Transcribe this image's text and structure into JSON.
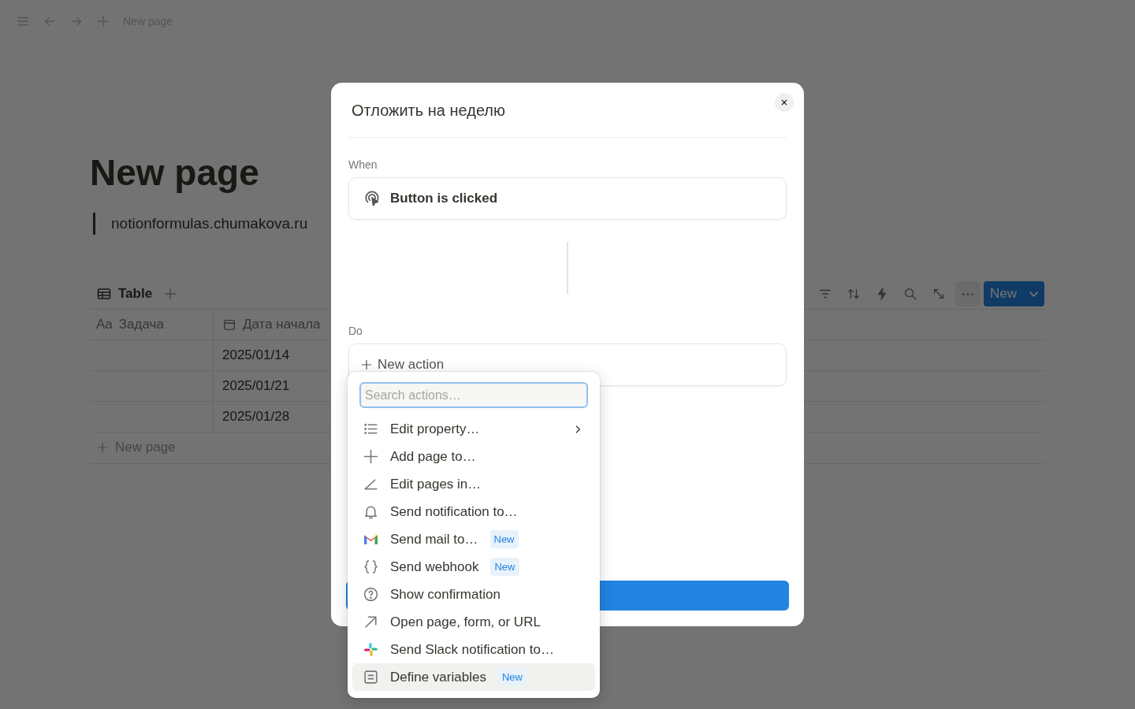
{
  "topbar": {
    "title": "New page"
  },
  "page": {
    "title": "New page",
    "quote": "notionformulas.chumakova.ru"
  },
  "database": {
    "view_tab": "Table",
    "new_button": "New",
    "columns": [
      {
        "label": "Задача",
        "kind": "title",
        "prefix": "Aa"
      },
      {
        "label": "Дата начала",
        "kind": "date"
      }
    ],
    "rows": [
      {
        "start_date": "2025/01/14"
      },
      {
        "start_date": "2025/01/21"
      },
      {
        "start_date": "2025/01/28"
      }
    ],
    "add_row": "New page"
  },
  "modal": {
    "title": "Отложить на неделю",
    "trigger_label": "When",
    "trigger": "Button is clicked",
    "action_label": "Do",
    "new_action": "New action"
  },
  "menu": {
    "search_placeholder": "Search actions…",
    "items": [
      {
        "label": "Edit property…",
        "kind": "list",
        "submenu": true,
        "selected": false
      },
      {
        "label": "Add page to…",
        "kind": "plus",
        "submenu": false,
        "selected": false
      },
      {
        "label": "Edit pages in…",
        "kind": "angle",
        "submenu": false,
        "selected": false
      },
      {
        "label": "Send notification to…",
        "kind": "bell",
        "submenu": false,
        "selected": false
      },
      {
        "label": "Send mail to…",
        "kind": "mail",
        "badge": "New",
        "submenu": false,
        "selected": false
      },
      {
        "label": "Send webhook",
        "kind": "braces",
        "badge": "New",
        "submenu": false,
        "selected": false
      },
      {
        "label": "Show confirmation",
        "kind": "question",
        "submenu": false,
        "selected": false
      },
      {
        "label": "Open page, form, or URL",
        "kind": "arrow",
        "submenu": false,
        "selected": false
      },
      {
        "label": "Send Slack notification to…",
        "kind": "slack",
        "submenu": false,
        "selected": false
      },
      {
        "label": "Define variables",
        "kind": "variables",
        "badge": "New",
        "submenu": false,
        "selected": true
      }
    ]
  }
}
